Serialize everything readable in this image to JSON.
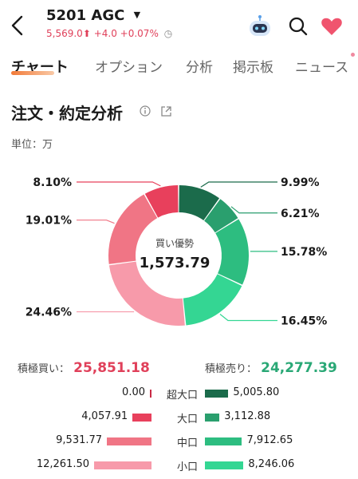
{
  "header": {
    "code": "5201",
    "name": "AGC",
    "price": "5,569.0",
    "change": "+4.0",
    "change_pct": "+0.07%"
  },
  "tabs": [
    {
      "label": "チャート",
      "active": true
    },
    {
      "label": "オプション"
    },
    {
      "label": "分析"
    },
    {
      "label": "掲示板"
    },
    {
      "label": "ニュース"
    }
  ],
  "section": {
    "title": "注文・約定分析",
    "unit": "単位：万"
  },
  "donut": {
    "center_label": "買い優勢",
    "center_value": "1,573.79"
  },
  "totals": {
    "buy_label": "積極買い：",
    "buy_value": "25,851.18",
    "sell_label": "積極売り：",
    "sell_value": "24,277.39"
  },
  "colors": {
    "accent_orange": "#f27a38",
    "buy_red": "#e0405a",
    "sell_green": "#2aa876",
    "buy_large": "#e8405c",
    "buy_mid": "#f07585",
    "buy_small": "#f79aaa",
    "sell_xlarge": "#1b6b4b",
    "sell_large": "#2a9f6e",
    "sell_mid": "#2dbd80",
    "sell_small": "#34d693"
  },
  "chart_data": {
    "type": "pie",
    "slices": [
      {
        "side": "sell",
        "category": "超大口",
        "pct": 9.99,
        "label": "9.99%",
        "color": "#1b6b4b"
      },
      {
        "side": "sell",
        "category": "大口",
        "pct": 6.21,
        "label": "6.21%",
        "color": "#2a9f6e"
      },
      {
        "side": "sell",
        "category": "中口",
        "pct": 15.78,
        "label": "15.78%",
        "color": "#2dbd80"
      },
      {
        "side": "sell",
        "category": "小口",
        "pct": 16.45,
        "label": "16.45%",
        "color": "#34d693"
      },
      {
        "side": "buy",
        "category": "小口",
        "pct": 24.46,
        "label": "24.46%",
        "color": "#f79aaa"
      },
      {
        "side": "buy",
        "category": "中口",
        "pct": 19.01,
        "label": "19.01%",
        "color": "#f07585"
      },
      {
        "side": "buy",
        "category": "大口",
        "pct": 8.1,
        "label": "8.10%",
        "color": "#e8405c"
      },
      {
        "side": "buy",
        "category": "超大口",
        "pct": 0.0,
        "label": "",
        "color": "#c92a45"
      }
    ]
  },
  "breakdown": [
    {
      "category": "超大口",
      "buy": "0.00",
      "sell": "5,005.80",
      "buy_num": 0.0,
      "sell_num": 5005.8,
      "buy_color": "#c92a45",
      "sell_color": "#1b6b4b"
    },
    {
      "category": "大口",
      "buy": "4,057.91",
      "sell": "3,112.88",
      "buy_num": 4057.91,
      "sell_num": 3112.88,
      "buy_color": "#e8405c",
      "sell_color": "#2a9f6e"
    },
    {
      "category": "中口",
      "buy": "9,531.77",
      "sell": "7,912.65",
      "buy_num": 9531.77,
      "sell_num": 7912.65,
      "buy_color": "#f07585",
      "sell_color": "#2dbd80"
    },
    {
      "category": "小口",
      "buy": "12,261.50",
      "sell": "8,246.06",
      "buy_num": 12261.5,
      "sell_num": 8246.06,
      "buy_color": "#f79aaa",
      "sell_color": "#34d693"
    }
  ]
}
